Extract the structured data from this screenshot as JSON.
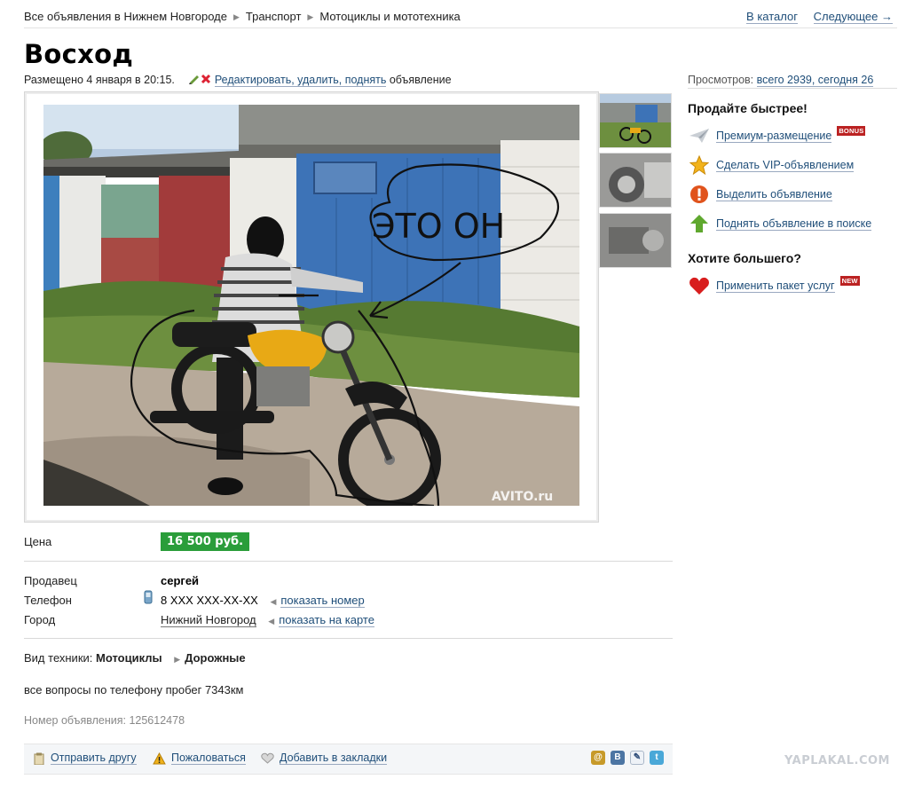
{
  "breadcrumb": {
    "items": [
      "Все объявления в Нижнем Новгороде",
      "Транспорт",
      "Мотоциклы и мототехника"
    ]
  },
  "topnav": {
    "catalog": "В каталог",
    "next": "Следующее →"
  },
  "ad": {
    "title": "Восход",
    "posted": "Размещено 4 января в 20:15.",
    "edit_link": "Редактировать, удалить, поднять",
    "edit_suffix": "объявление",
    "views_label": "Просмотров:",
    "views_value": "всего 2939, сегодня 26"
  },
  "photo": {
    "scribble_text": "ЭТО ОН",
    "watermark": "AVITO.ru"
  },
  "sidebar": {
    "heading1": "Продайте быстрее!",
    "items": [
      {
        "label": "Премиум-размещение",
        "icon": "paper-plane-icon",
        "badge": "BONUS"
      },
      {
        "label": "Сделать VIP-объявлением",
        "icon": "star-icon"
      },
      {
        "label": "Выделить объявление",
        "icon": "exclamation-icon"
      },
      {
        "label": "Поднять объявление в поиске",
        "icon": "arrow-up-icon"
      }
    ],
    "heading2": "Хотите большего?",
    "package": {
      "label": "Применить пакет услуг",
      "icon": "heart-icon",
      "badge": "NEW"
    }
  },
  "details": {
    "price_label": "Цена",
    "price_value": "16 500 руб.",
    "seller_label": "Продавец",
    "seller_value": "сергей",
    "phone_label": "Телефон",
    "phone_value": "8 XXX XXX-XX-XX",
    "phone_link": "показать номер",
    "city_label": "Город",
    "city_value": "Нижний Новгород",
    "city_link": "показать на карте",
    "type_label": "Вид техники:",
    "type_value1": "Мотоциклы",
    "type_value2": "Дорожные",
    "description": "все вопросы по телефону пробег 7343км",
    "ad_number_label": "Номер объявления:",
    "ad_number_value": "125612478"
  },
  "footer": {
    "send": "Отправить другу",
    "complain": "Пожаловаться",
    "bookmark": "Добавить в закладки",
    "share": [
      "@",
      "В",
      "✎",
      "t"
    ]
  },
  "site_watermark": "YAPLAKAL.COM",
  "colors": {
    "link": "#1f4e79",
    "price_bg": "#2a9d3a",
    "badge": "#b22222"
  }
}
